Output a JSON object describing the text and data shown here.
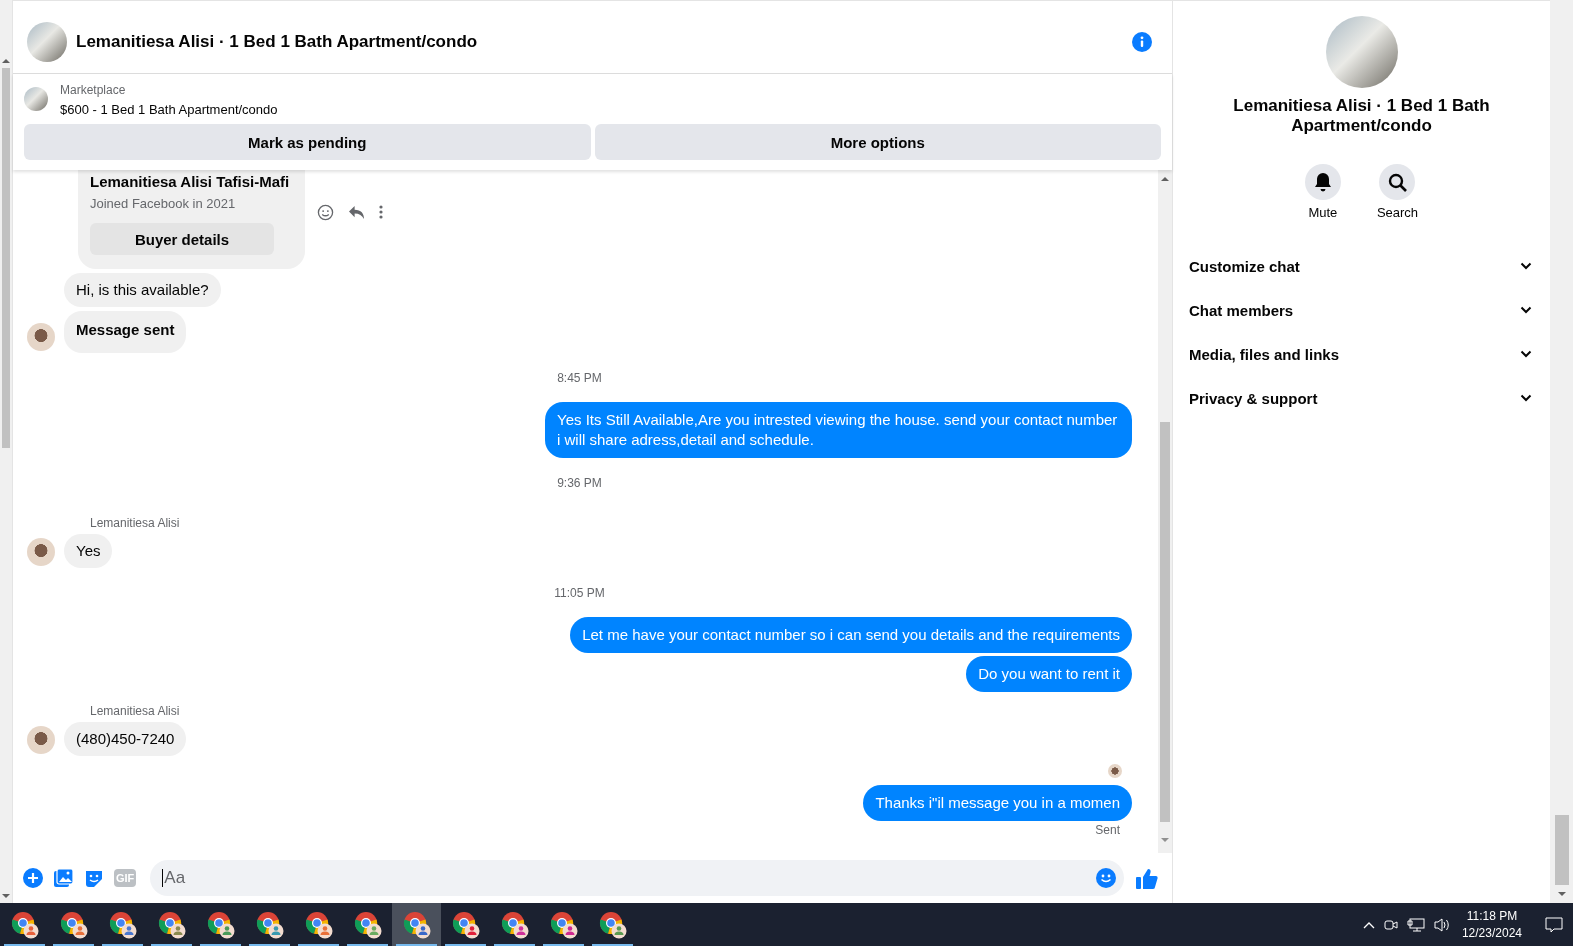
{
  "header": {
    "title": "Lemanitiesa Alisi · 1 Bed 1 Bath Apartment/condo"
  },
  "listing": {
    "source": "Marketplace",
    "title": "$600 - 1 Bed 1 Bath Apartment/condo",
    "buttons": [
      "Mark as pending",
      "More options"
    ]
  },
  "messages": [
    {
      "kind": "profile",
      "name": "Lemanitiesa Alisi Tafisi-Mafi",
      "subtitle": "Joined Facebook in 2021",
      "button": "Buyer details"
    },
    {
      "kind": "incoming",
      "text": "Hi, is this available?",
      "avatar": false,
      "bold": false
    },
    {
      "kind": "incoming",
      "text": "Message sent",
      "avatar": true,
      "bold": true
    },
    {
      "kind": "time",
      "text": "8:45 PM"
    },
    {
      "kind": "outgoing",
      "text": "Yes Its Still Available,Are you intrested viewing the house. send your contact number i will share adress,detail and schedule."
    },
    {
      "kind": "time",
      "text": "9:36 PM"
    },
    {
      "kind": "sender",
      "text": "Lemanitiesa Alisi"
    },
    {
      "kind": "incoming",
      "text": "Yes",
      "avatar": true,
      "bold": false
    },
    {
      "kind": "time",
      "text": "11:05 PM"
    },
    {
      "kind": "outgoing",
      "text": "Let me have your contact number so i can send you details and the requirements"
    },
    {
      "kind": "outgoing",
      "text": "Do you want to rent it"
    },
    {
      "kind": "sender",
      "text": "Lemanitiesa Alisi"
    },
    {
      "kind": "incoming",
      "text": "(480)450-7240",
      "avatar": true,
      "bold": false
    },
    {
      "kind": "seen"
    },
    {
      "kind": "outgoing",
      "text": "Thanks i\"il message you in a momen"
    },
    {
      "kind": "status",
      "text": "Sent"
    }
  ],
  "composer": {
    "gif_label": "GIF",
    "placeholder": "Aa"
  },
  "details": {
    "title": "Lemanitiesa Alisi · 1 Bed 1 Bath Apartment/condo",
    "actions": [
      {
        "kind": "mute",
        "label": "Mute"
      },
      {
        "kind": "search",
        "label": "Search"
      }
    ],
    "sections": [
      {
        "label": "Customize chat",
        "expanded": false
      },
      {
        "label": "Chat members",
        "expanded": false
      },
      {
        "label": "Media, files and links",
        "expanded": false
      },
      {
        "label": "Privacy & support",
        "expanded": false
      }
    ]
  },
  "taskbar": {
    "apps": [
      {
        "selected": false,
        "color": "#e8603a"
      },
      {
        "selected": false,
        "color": "#e8703a"
      },
      {
        "selected": false,
        "color": "#4a78d0"
      },
      {
        "selected": false,
        "color": "#8a8a50"
      },
      {
        "selected": false,
        "color": "#4a9a5a"
      },
      {
        "selected": false,
        "color": "#3a9ab0"
      },
      {
        "selected": false,
        "color": "#e8703a"
      },
      {
        "selected": false,
        "color": "#6aaa60"
      },
      {
        "selected": true,
        "color": "#3a68c8"
      },
      {
        "selected": false,
        "color": "#e0203a"
      },
      {
        "selected": false,
        "color": "#d0309a"
      },
      {
        "selected": false,
        "color": "#d02890"
      },
      {
        "selected": false,
        "color": "#5a9a50"
      }
    ],
    "time": "11:18 PM",
    "date": "12/23/2024"
  }
}
